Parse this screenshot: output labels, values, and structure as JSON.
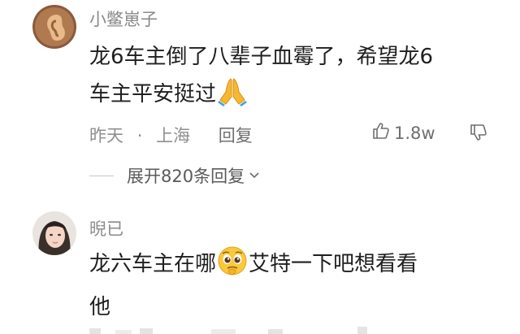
{
  "comments": [
    {
      "username": "小鳖崽子",
      "text_line1": "龙6车主倒了八辈子血霉了，希望龙6",
      "text_line2": "车主平安挺过",
      "emoji": "folded-hands-emoji",
      "time": "昨天",
      "location": "上海",
      "separator": "·",
      "reply_label": "回复",
      "likes": "1.8w",
      "expand_label": "展开820条回复"
    },
    {
      "username": "晲已",
      "text_part1": "龙六车主在哪",
      "emoji": "pleading-face-emoji",
      "text_part2": "艾特一下吧想看看",
      "text_line2": "他"
    }
  ],
  "colors": {
    "background": "#ffffff",
    "username": "#8a8a8a",
    "text": "#1f1f1f",
    "meta": "#8f8f8f"
  }
}
